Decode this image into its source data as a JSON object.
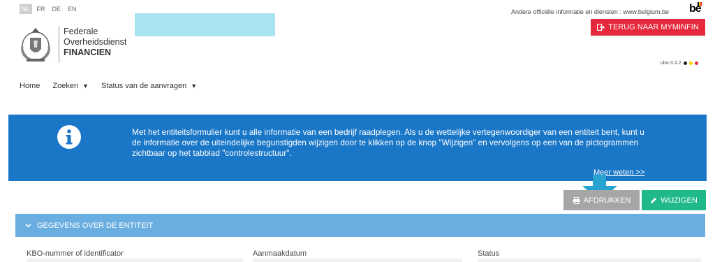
{
  "top": {
    "languages": [
      {
        "code": "NL",
        "active": true
      },
      {
        "code": "FR",
        "active": false
      },
      {
        "code": "DE",
        "active": false
      },
      {
        "code": "EN",
        "active": false
      }
    ],
    "belgium_text": "Andere officiële informatie en diensten : www.belgium.be",
    "be_logo": "be",
    "back_button": "TERUG NAAR MYMINFIN"
  },
  "logo": {
    "line1": "Federale",
    "line2": "Overheidsdienst",
    "line3": "FINANCIEN"
  },
  "version": "ubo-3.4.2",
  "nav": {
    "home": "Home",
    "search": "Zoeken",
    "status": "Status van de aanvragen"
  },
  "info": {
    "text": "Met het entiteitsformulier kunt u alle informatie van een bedrijf raadplegen. Als u de wettelijke vertegenwoordiger van een entiteit bent, kunt u de informatie over de uiteindelijke begunstigden wijzigen door te klikken op de knop \"Wijzigen\" en vervolgens op een van de pictogrammen zichtbaar op het tabblad \"controlestructuur\".",
    "more_link": "Meer weten >>"
  },
  "actions": {
    "print": "AFDRUKKEN",
    "edit": "WIJZIGEN"
  },
  "section": {
    "title": "GEGEVENS OVER DE ENTITEIT"
  },
  "fields": {
    "kbo": "KBO-nummer of identificator",
    "created": "Aanmaakdatum",
    "status": "Status"
  },
  "colors": {
    "banner": "#1a77c8",
    "back_button": "#e5283b",
    "edit_button": "#1fb98c",
    "print_button": "#a6a6a6",
    "section_header": "#6aaee1",
    "arrow": "#26a4cf"
  },
  "icons": [
    "info-icon",
    "exit-icon",
    "printer-icon",
    "pencil-icon",
    "chevron-down-icon",
    "coat-of-arms-icon"
  ]
}
